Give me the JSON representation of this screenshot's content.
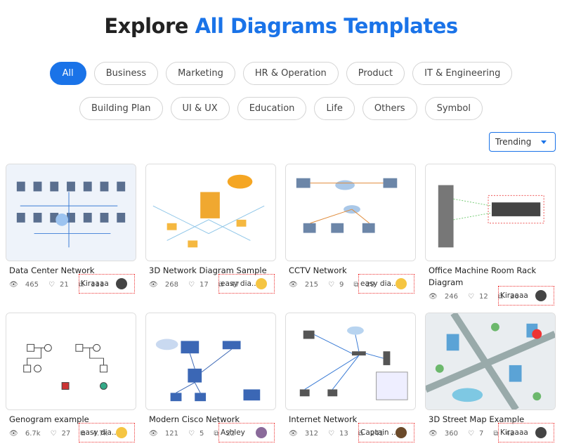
{
  "header": {
    "title_prefix": "Explore ",
    "title_highlight": "All Diagrams Templates"
  },
  "filters": {
    "row1": [
      "All",
      "Business",
      "Marketing",
      "HR & Operation",
      "Product",
      "IT & Engineering"
    ],
    "row2": [
      "Building Plan",
      "UI & UX",
      "Education",
      "Life",
      "Others",
      "Symbol"
    ],
    "active": "All"
  },
  "sort": {
    "selected": "Trending"
  },
  "accent": "#1a73e8",
  "cards": [
    {
      "title": "Data Center Network",
      "views": "465",
      "likes": "21",
      "copies": "111",
      "author": "Kiraaaa",
      "avatar": "#444"
    },
    {
      "title": "3D Network Diagram Sample",
      "views": "268",
      "likes": "17",
      "copies": "47",
      "author": "easy dia...",
      "avatar": "#f5c542"
    },
    {
      "title": "CCTV Network",
      "views": "215",
      "likes": "9",
      "copies": "29",
      "author": "easy dia...",
      "avatar": "#f5c542"
    },
    {
      "title": "Office Machine Room Rack Diagram",
      "views": "246",
      "likes": "12",
      "copies": "26",
      "author": "Kiraaaa",
      "avatar": "#444"
    },
    {
      "title": "Genogram example",
      "views": "6.7k",
      "likes": "27",
      "copies": "4.7k",
      "author": "easy dia...",
      "avatar": "#f5c542"
    },
    {
      "title": "Modern Cisco Network",
      "views": "121",
      "likes": "5",
      "copies": "22",
      "author": "Ashley",
      "avatar": "#8a6a9a"
    },
    {
      "title": "Internet Network",
      "views": "312",
      "likes": "13",
      "copies": "241",
      "author": "Captain ...",
      "avatar": "#6b4a2a"
    },
    {
      "title": "3D Street Map Example",
      "views": "360",
      "likes": "7",
      "copies": "42",
      "author": "Kiraaaa",
      "avatar": "#444"
    }
  ]
}
